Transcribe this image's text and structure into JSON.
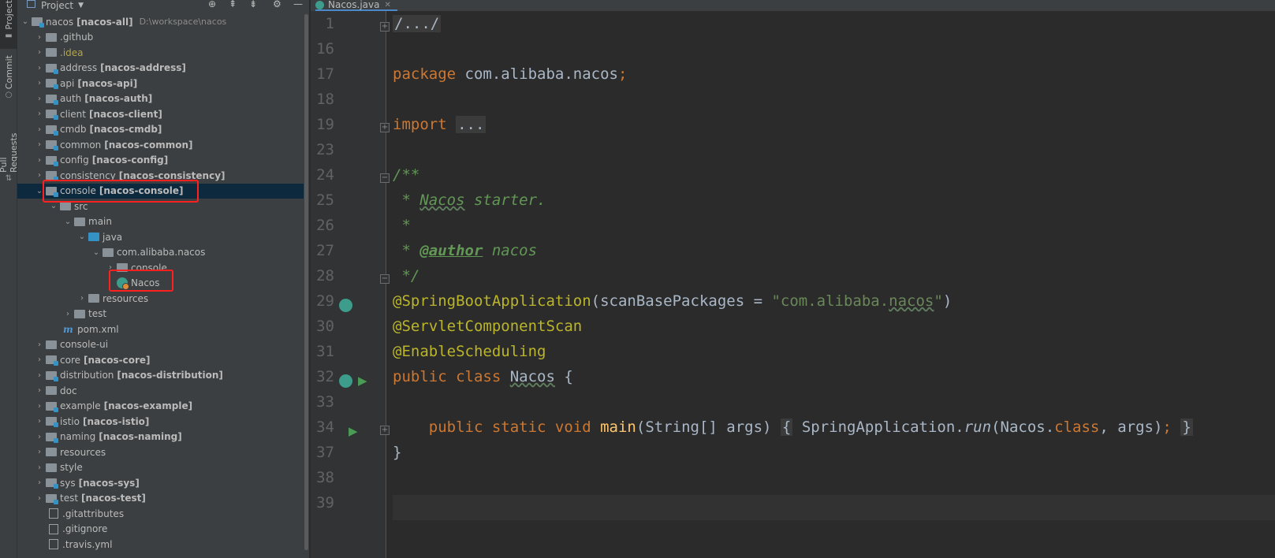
{
  "stripe": {
    "project_label": "Project",
    "commit_label": "Commit",
    "pull_requests_label": "Pull Requests"
  },
  "project_panel": {
    "title": "Project",
    "root": {
      "name": "nacos",
      "module": "[nacos-all]",
      "path": "D:\\workspace\\nacos"
    },
    "items": [
      {
        "name": ".github",
        "module": ""
      },
      {
        "name": ".idea",
        "module": ""
      },
      {
        "name": "address",
        "module": "[nacos-address]"
      },
      {
        "name": "api",
        "module": "[nacos-api]"
      },
      {
        "name": "auth",
        "module": "[nacos-auth]"
      },
      {
        "name": "client",
        "module": "[nacos-client]"
      },
      {
        "name": "cmdb",
        "module": "[nacos-cmdb]"
      },
      {
        "name": "common",
        "module": "[nacos-common]"
      },
      {
        "name": "config",
        "module": "[nacos-config]"
      },
      {
        "name": "consistency",
        "module": "[nacos-consistency]"
      },
      {
        "name": "console",
        "module": "[nacos-console]"
      },
      {
        "name": "src",
        "module": ""
      },
      {
        "name": "main",
        "module": ""
      },
      {
        "name": "java",
        "module": ""
      },
      {
        "name": "com.alibaba.nacos",
        "module": ""
      },
      {
        "name": "console",
        "module": ""
      },
      {
        "name": "Nacos",
        "module": ""
      },
      {
        "name": "resources",
        "module": ""
      },
      {
        "name": "test",
        "module": ""
      },
      {
        "name": "pom.xml",
        "module": ""
      },
      {
        "name": "console-ui",
        "module": ""
      },
      {
        "name": "core",
        "module": "[nacos-core]"
      },
      {
        "name": "distribution",
        "module": "[nacos-distribution]"
      },
      {
        "name": "doc",
        "module": ""
      },
      {
        "name": "example",
        "module": "[nacos-example]"
      },
      {
        "name": "istio",
        "module": "[nacos-istio]"
      },
      {
        "name": "naming",
        "module": "[nacos-naming]"
      },
      {
        "name": "resources",
        "module": ""
      },
      {
        "name": "style",
        "module": ""
      },
      {
        "name": "sys",
        "module": "[nacos-sys]"
      },
      {
        "name": "test",
        "module": "[nacos-test]"
      },
      {
        "name": ".gitattributes",
        "module": ""
      },
      {
        "name": ".gitignore",
        "module": ""
      },
      {
        "name": ".travis.yml",
        "module": ""
      }
    ]
  },
  "editor": {
    "tab_name": "Nacos.java",
    "line_numbers": [
      "1",
      "16",
      "17",
      "18",
      "19",
      "23",
      "24",
      "25",
      "26",
      "27",
      "28",
      "29",
      "30",
      "31",
      "32",
      "33",
      "34",
      "37",
      "38",
      "39"
    ],
    "code": {
      "l1": "/.../",
      "l17_kw": "package",
      "l17_pkg": " com.alibaba.nacos",
      "l17_semi": ";",
      "l19_kw": "import",
      "l19_fold": "...",
      "l24": "/**",
      "l25_star": " * ",
      "l25_word": "Nacos",
      "l25_rest": " starter.",
      "l26": " *",
      "l27_star": " * ",
      "l27_tag": "@author",
      "l27_rest": " nacos",
      "l28": " */",
      "l29_an": "@SpringBootApplication",
      "l29_open": "(scanBasePackages = ",
      "l29_str_a": "\"com.alibaba.",
      "l29_str_b": "nacos",
      "l29_str_c": "\"",
      "l29_close": ")",
      "l30_an": "@ServletComponentScan",
      "l31_an": "@EnableScheduling",
      "l32_kw": "public class ",
      "l32_name": "Nacos",
      "l32_brace": " {",
      "l34_kw": "public static void ",
      "l34_fn": "main",
      "l34_params": "(String[] args)",
      "l34_ob": "{",
      "l34_call_a": "SpringApplication.",
      "l34_run": "run",
      "l34_call_b": "(Nacos.",
      "l34_class": "class",
      "l34_call_c": ", args)",
      "l34_semi": ";",
      "l34_cb": "}",
      "l37": "}"
    }
  }
}
